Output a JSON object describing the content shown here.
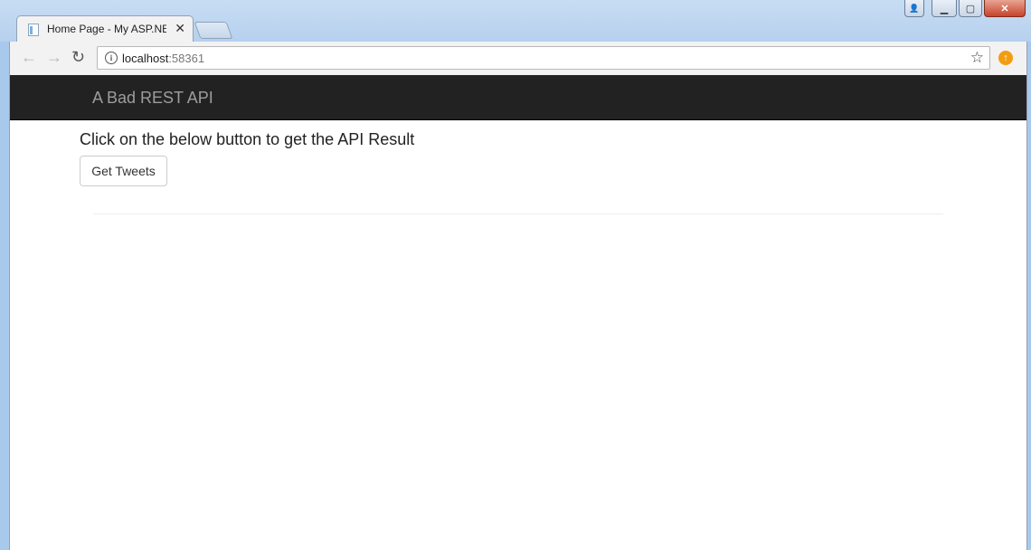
{
  "browser": {
    "tab_title": "Home Page - My ASP.NE",
    "tab_close": "✕",
    "url_host": "localhost",
    "url_port": ":58361",
    "back_glyph": "←",
    "forward_glyph": "→",
    "reload_glyph": "↻",
    "info_glyph": "i",
    "star_glyph": "☆",
    "window_min": "▁",
    "window_max": "▢",
    "window_close": "✕",
    "window_user": "👤",
    "icons": {
      "tab": "page-icon",
      "back": "arrow-left-icon",
      "forward": "arrow-right-icon",
      "reload": "reload-icon",
      "info": "info-icon",
      "star": "star-icon",
      "extension": "update-icon"
    }
  },
  "page": {
    "brand": "A Bad REST API",
    "instruction": "Click on the below button to get the API Result",
    "button_label": "Get Tweets",
    "colors": {
      "navbar": "#222222",
      "brand_text": "#9d9d9d"
    }
  }
}
